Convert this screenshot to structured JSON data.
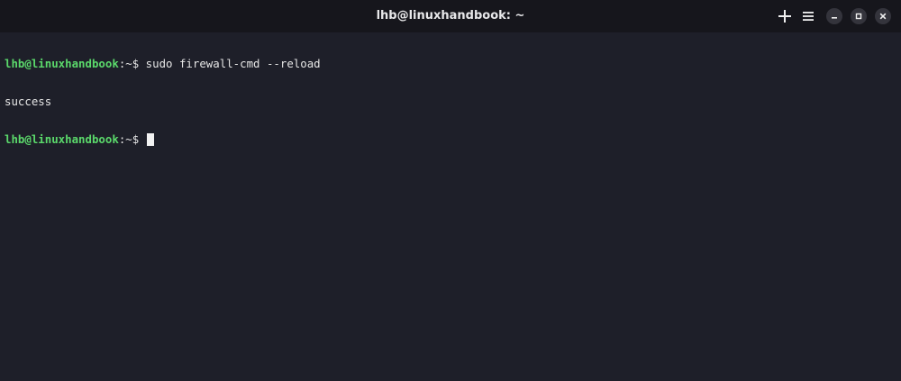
{
  "window": {
    "title": "lhb@linuxhandbook: ~"
  },
  "toolbar": {
    "new_tab_icon": "plus-icon",
    "menu_icon": "hamburger-menu-icon",
    "minimize_icon": "minimize-icon",
    "maximize_icon": "maximize-icon",
    "close_icon": "close-icon"
  },
  "terminal": {
    "lines": [
      {
        "prompt": "lhb@linuxhandbook",
        "suffix": ":~$ ",
        "command": "sudo firewall-cmd --reload"
      },
      {
        "output": "success"
      },
      {
        "prompt": "lhb@linuxhandbook",
        "suffix": ":~$ ",
        "command": ""
      }
    ]
  },
  "colors": {
    "background": "#1e1f29",
    "titlebar": "#16161c",
    "prompt": "#5bd96b",
    "text": "#e6e6e6"
  }
}
